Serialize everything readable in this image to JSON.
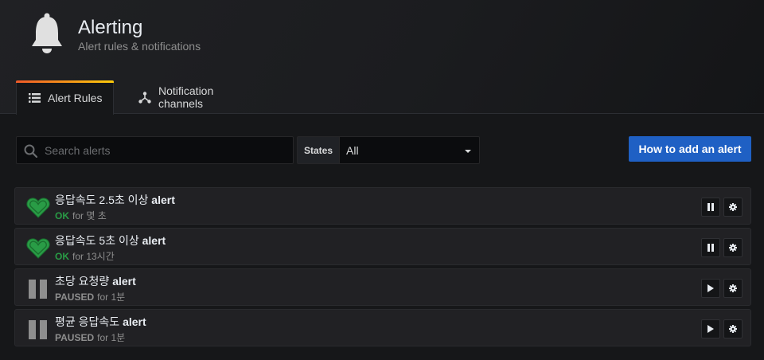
{
  "header": {
    "title": "Alerting",
    "subtitle": "Alert rules & notifications",
    "icon": "bell-icon"
  },
  "tabs": [
    {
      "label": "Alert Rules",
      "icon": "list-icon",
      "active": true
    },
    {
      "label": "Notification channels",
      "icon": "share-icon",
      "active": false
    }
  ],
  "toolbar": {
    "search_placeholder": "Search alerts",
    "search_value": "",
    "states_label": "States",
    "states_value": "All",
    "help_button": "How to add an alert"
  },
  "colors": {
    "accent": "#1f60c4",
    "ok": "#299c46",
    "paused": "#8e8e8e",
    "tab_gradient_start": "#f05a28",
    "tab_gradient_end": "#fbca0a"
  },
  "alerts": [
    {
      "name_main": "응답속도 2.5초 이상",
      "name_suffix": "alert",
      "state": "OK",
      "duration": "for 몇 초",
      "state_icon": "heart-icon",
      "action_icon": "pause-icon"
    },
    {
      "name_main": "응답속도 5초 이상",
      "name_suffix": "alert",
      "state": "OK",
      "duration": "for 13시간",
      "state_icon": "heart-icon",
      "action_icon": "pause-icon"
    },
    {
      "name_main": "초당 요청량",
      "name_suffix": "alert",
      "state": "PAUSED",
      "duration": "for 1분",
      "state_icon": "pause-icon",
      "action_icon": "play-icon"
    },
    {
      "name_main": "평균 응답속도",
      "name_suffix": "alert",
      "state": "PAUSED",
      "duration": "for 1분",
      "state_icon": "pause-icon",
      "action_icon": "play-icon"
    }
  ]
}
